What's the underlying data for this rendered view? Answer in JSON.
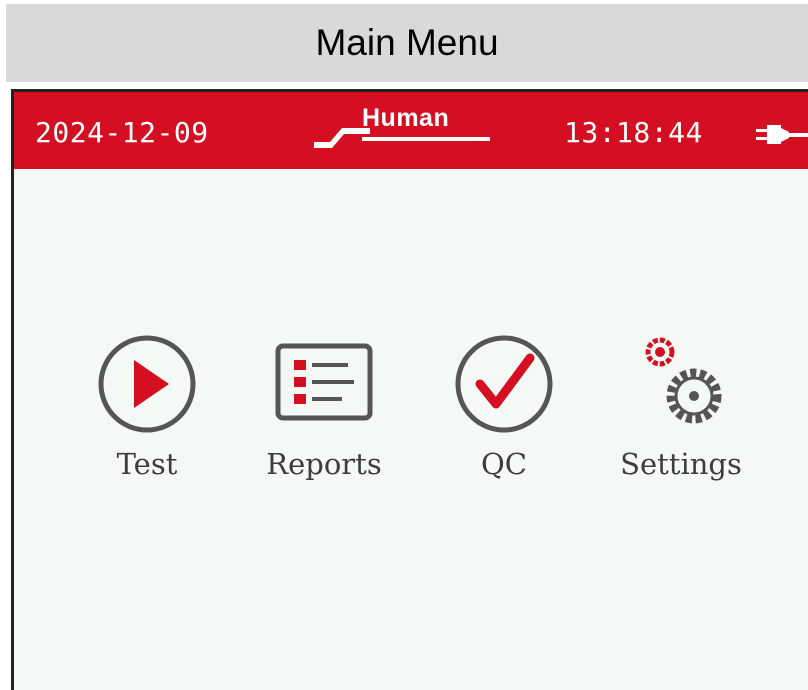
{
  "page_title": "Main Menu",
  "status_bar": {
    "date": "2024-12-09",
    "brand": "Human",
    "time": "13:18:44",
    "power_icon": "plug-icon"
  },
  "menu": [
    {
      "label": "Test",
      "icon": "play-icon"
    },
    {
      "label": "Reports",
      "icon": "list-icon"
    },
    {
      "label": "QC",
      "icon": "checkmark-icon"
    },
    {
      "label": "Settings",
      "icon": "gears-icon"
    }
  ],
  "colors": {
    "accent": "#d40f22",
    "icon_gray": "#555555",
    "screen_background": "#f5f9f6",
    "banner_background": "#d9d9d9"
  }
}
